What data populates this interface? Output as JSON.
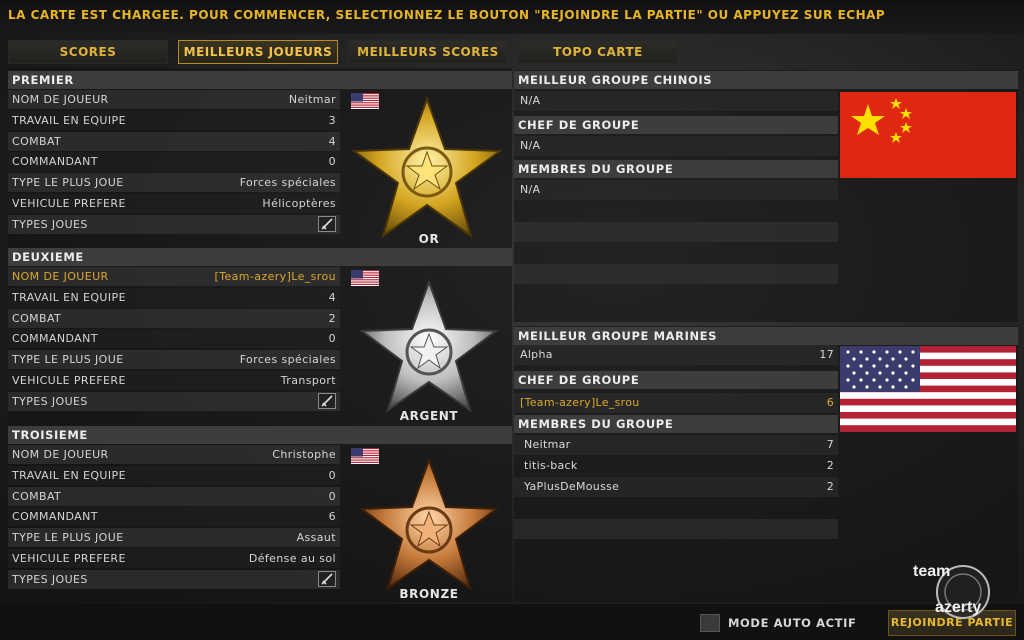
{
  "top_message": "LA CARTE EST CHARGEE. POUR COMMENCER, SELECTIONNEZ LE BOUTON \"REJOINDRE LA PARTIE\" OU APPUYEZ SUR ECHAP",
  "tabs": [
    {
      "label": "SCORES",
      "active": false
    },
    {
      "label": "MEILLEURS JOUEURS",
      "active": true
    },
    {
      "label": "MEILLEURS SCORES",
      "active": false
    },
    {
      "label": "TOPO CARTE",
      "active": false
    }
  ],
  "players": [
    {
      "heading": "PREMIER",
      "medal_label": "OR",
      "medal_color": "#d4a520",
      "rows": [
        {
          "key": "NOM DE JOUEUR",
          "value": "Neitmar"
        },
        {
          "key": "TRAVAIL EN EQUIPE",
          "value": "3"
        },
        {
          "key": "COMBAT",
          "value": "4"
        },
        {
          "key": "COMMANDANT",
          "value": "0"
        },
        {
          "key": "TYPE LE PLUS JOUE",
          "value": "Forces spéciales"
        },
        {
          "key": "VEHICULE PREFERE",
          "value": "Hélicoptères"
        },
        {
          "key": "TYPES JOUES",
          "value": ""
        }
      ]
    },
    {
      "heading": "DEUXIEME",
      "medal_label": "ARGENT",
      "medal_color": "#c8c8c8",
      "rows": [
        {
          "key": "NOM DE JOUEUR",
          "value": "[Team-azery]Le_srou"
        },
        {
          "key": "TRAVAIL EN EQUIPE",
          "value": "4"
        },
        {
          "key": "COMBAT",
          "value": "2"
        },
        {
          "key": "COMMANDANT",
          "value": "0"
        },
        {
          "key": "TYPE LE PLUS JOUE",
          "value": "Forces spéciales"
        },
        {
          "key": "VEHICULE PREFERE",
          "value": "Transport"
        },
        {
          "key": "TYPES JOUES",
          "value": ""
        }
      ]
    },
    {
      "heading": "TROISIEME",
      "medal_label": "BRONZE",
      "medal_color": "#c57a3a",
      "rows": [
        {
          "key": "NOM DE JOUEUR",
          "value": "Christophe"
        },
        {
          "key": "TRAVAIL EN EQUIPE",
          "value": "0"
        },
        {
          "key": "COMBAT",
          "value": "0"
        },
        {
          "key": "COMMANDANT",
          "value": "6"
        },
        {
          "key": "TYPE LE PLUS JOUE",
          "value": "Assaut"
        },
        {
          "key": "VEHICULE PREFERE",
          "value": "Défense au sol"
        },
        {
          "key": "TYPES JOUES",
          "value": ""
        }
      ]
    }
  ],
  "chinese_group": {
    "heading": "MEILLEUR GROUPE CHINOIS",
    "group_name": "N/A",
    "leader_heading": "CHEF DE GROUPE",
    "leader": "N/A",
    "members_heading": "MEMBRES DU GROUPE",
    "members": "N/A"
  },
  "marines_group": {
    "heading": "MEILLEUR GROUPE MARINES",
    "group_name": "Alpha",
    "group_score": "17",
    "leader_heading": "CHEF DE GROUPE",
    "leader": "[Team-azery]Le_srou",
    "leader_score": "6",
    "members_heading": "MEMBRES DU GROUPE",
    "members": [
      {
        "name": "Neitmar",
        "score": "7"
      },
      {
        "name": "titis-back",
        "score": "2"
      },
      {
        "name": "YaPlusDeMousse",
        "score": "2"
      }
    ]
  },
  "bottom": {
    "auto_mode_label": "MODE AUTO ACTIF",
    "join_button": "REJOINDRE PARTIE"
  },
  "logo_text": [
    "team",
    "azerty"
  ],
  "colors": {
    "accent": "#e8b422",
    "highlight": "#dba72a"
  },
  "icons": [
    "flag-usa-icon",
    "flag-china-icon",
    "star-medal-icon",
    "helicopter-icon",
    "rifle-icon",
    "team-azerty-logo"
  ]
}
